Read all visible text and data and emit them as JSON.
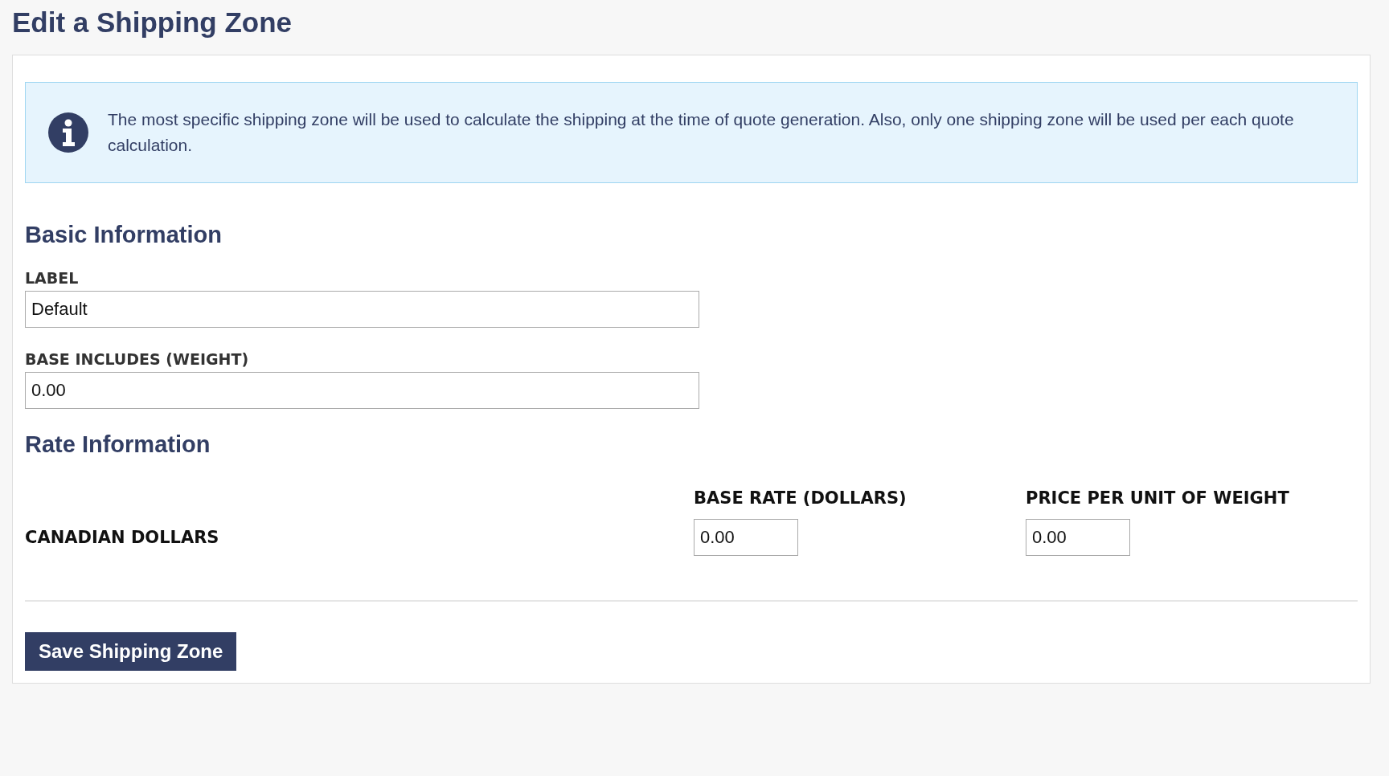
{
  "title": "Edit a Shipping Zone",
  "notice": {
    "text": "The most specific shipping zone will be used to calculate the shipping at the time of quote generation. Also, only one shipping zone will be used per each quote calculation."
  },
  "basic_information": {
    "heading": "Basic Information",
    "fields": [
      {
        "label": "LABEL",
        "value": "Default"
      },
      {
        "label": "BASE INCLUDES (WEIGHT)",
        "value": "0.00"
      }
    ]
  },
  "rate_information": {
    "heading": "Rate Information",
    "columns": [
      "BASE RATE (DOLLARS)",
      "PRICE PER UNIT OF WEIGHT"
    ],
    "rows": [
      {
        "currency": "CANADIAN DOLLARS",
        "values": [
          "0.00",
          "0.00"
        ]
      }
    ]
  },
  "save_button": "Save Shipping Zone"
}
